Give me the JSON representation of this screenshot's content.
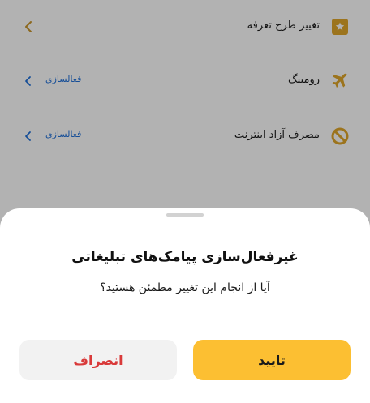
{
  "settings": {
    "items": [
      {
        "label": "تغییر طرح تعرفه",
        "icon": "star-badge-icon",
        "action": ""
      },
      {
        "label": "رومینگ",
        "icon": "airplane-icon",
        "action": "فعالسازی"
      },
      {
        "label": "مصرف آزاد اینترنت",
        "icon": "prohibited-icon",
        "action": "فعالسازی"
      }
    ]
  },
  "dialog": {
    "title": "غیرفعال‌سازی پیامک‌های تبلیغاتی",
    "message": "آیا از انجام این تغییر مطمئن هستید؟",
    "confirm_label": "تایید",
    "cancel_label": "انصراف"
  },
  "colors": {
    "accent": "#fcbf32",
    "link": "#1e6fd9",
    "danger": "#d93a3a"
  }
}
